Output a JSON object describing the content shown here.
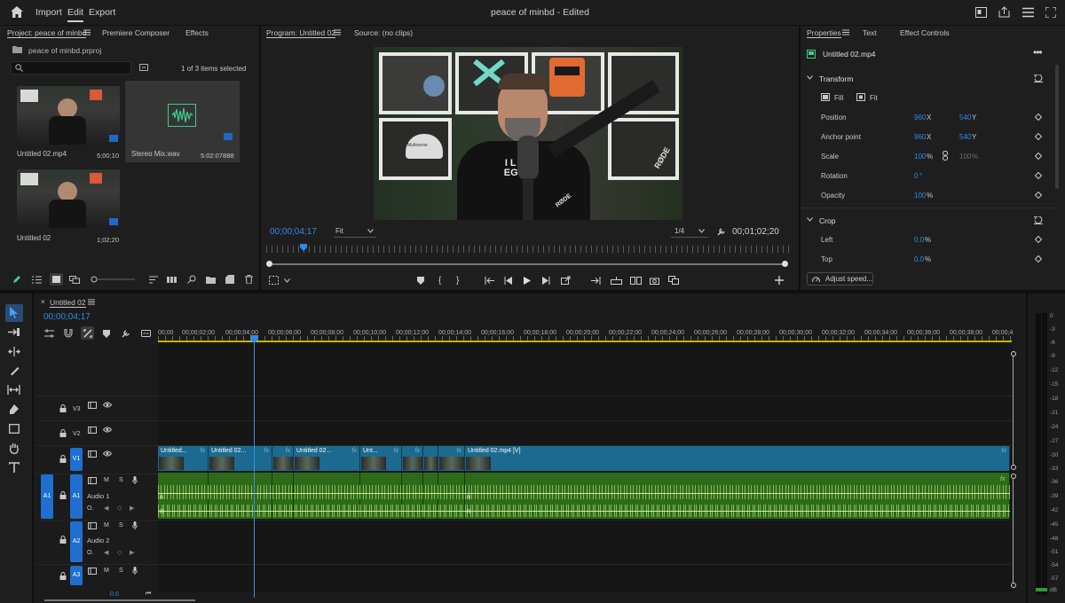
{
  "topbar": {
    "menu": [
      "Import",
      "Edit",
      "Export"
    ],
    "title": "peace of minbd",
    "status": "- Edited"
  },
  "project": {
    "tabs": [
      "Project: peace of minbd",
      "Premiere Composer",
      "Effects"
    ],
    "file": "peace of minbd.prproj",
    "selection": "1 of 3 items selected",
    "items": [
      {
        "name": "Untitled 02.mp4",
        "duration": "5;00;10"
      },
      {
        "name": "Stereo Mix.wav",
        "duration": "5:02:07888"
      },
      {
        "name": "Untitled 02",
        "duration": "1;02;20"
      }
    ]
  },
  "program": {
    "tabs": [
      "Program: Untitled 02",
      "Source: (no clips)"
    ],
    "timecode": "00;00;04;17",
    "fit": "Fit",
    "resolution": "1/4",
    "duration": "00;01;02;20",
    "video_text": {
      "shirt": "I L VE EGGD",
      "mic": "RØDE",
      "cap": "Multiverse"
    }
  },
  "properties": {
    "tabs": [
      "Properties",
      "Text",
      "Effect Controls"
    ],
    "clip": "Untitled 02.mp4",
    "transform": "Transform",
    "fill": "Fill",
    "fit": "Fit",
    "rows": [
      {
        "label": "Position",
        "v1": "960",
        "u1": "X",
        "v2": "540",
        "u2": "Y"
      },
      {
        "label": "Anchor point",
        "v1": "960",
        "u1": "X",
        "v2": "540",
        "u2": "Y"
      },
      {
        "label": "Scale",
        "v1": "100",
        "u1": "%",
        "v2": "100",
        "u2": "%"
      },
      {
        "label": "Rotation",
        "v1": "0",
        "u1": "°",
        "v2": "",
        "u2": ""
      },
      {
        "label": "Opacity",
        "v1": "100",
        "u1": "%",
        "v2": "",
        "u2": ""
      }
    ],
    "crop": "Crop",
    "crop_rows": [
      {
        "label": "Left",
        "v1": "0.0",
        "u1": "%"
      },
      {
        "label": "Top",
        "v1": "0.0",
        "u1": "%"
      }
    ],
    "adjust": "Adjust speed..."
  },
  "timeline": {
    "tab": "Untitled 02",
    "timecode": "00;00;04;17",
    "ruler": [
      "00;00",
      "00;00;02;00",
      "00;00;04;00",
      "00;00;06;00",
      "00;00;08;00",
      "00;00;10;00",
      "00;00;12;00",
      "00;00;14;00",
      "00;00;16;00",
      "00;00;18;00",
      "00;00;20;00",
      "00;00;22;00",
      "00;00;24;00",
      "00;00;26;00",
      "00;00;28;00",
      "00;00;30;00",
      "00;00;32;00",
      "00;00;34;00",
      "00;00;36;00",
      "00;00;38;00",
      "00;00;4"
    ],
    "tracks": {
      "v3": "V3",
      "v2": "V2",
      "v1": "V1",
      "a1": "A1",
      "a1name": "Audio 1",
      "a2": "A2",
      "a2name": "Audio 2",
      "a3": "A3",
      "m": "M",
      "s": "S",
      "vol": "0.0"
    },
    "clips": [
      {
        "name": "Untitled..."
      },
      {
        "name": "Untitled 02..."
      },
      {
        "name": ""
      },
      {
        "name": "Untitled 02..."
      },
      {
        "name": "Unt..."
      },
      {
        "name": ""
      },
      {
        "name": ""
      },
      {
        "name": ""
      },
      {
        "name": "Untitled 02.mp4 [V]"
      }
    ],
    "fx": "fx",
    "a_label": "R"
  },
  "meter": {
    "db": [
      "0",
      "-3",
      "-6",
      "-9",
      "-12",
      "-15",
      "-18",
      "-21",
      "-24",
      "-27",
      "-30",
      "-33",
      "-36",
      "-39",
      "-42",
      "-45",
      "-48",
      "-51",
      "-54",
      "-57",
      "dB"
    ]
  }
}
